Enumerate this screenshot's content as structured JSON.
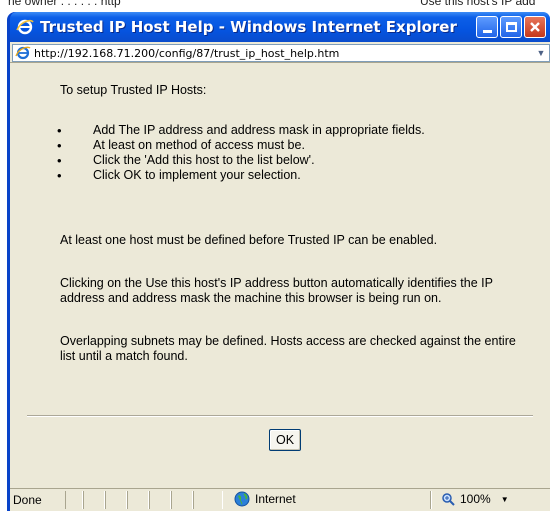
{
  "background": {
    "top_text_left": "ne owner . . . . . . http",
    "top_text_right": "Use this host's IP add"
  },
  "window": {
    "title": "Trusted IP Host Help - Windows Internet Explorer",
    "address_url": "http://192.168.71.200/config/87/trust_ip_host_help.htm"
  },
  "content": {
    "intro": "To setup Trusted IP Hosts:",
    "steps": [
      "Add The IP address and address mask in appropriate fields.",
      "At least on method of access must be.",
      "Click the 'Add this host to the list below'.",
      "Click OK to implement your selection."
    ],
    "paragraphs": [
      "At least one host must be defined before Trusted IP can be enabled.",
      "Clicking on the Use this host's IP address button automatically identifies the IP address and address mask the machine this browser is being run on.",
      "Overlapping subnets may be defined. Hosts access are checked against the entire list until a match found."
    ],
    "ok_label": "OK"
  },
  "statusbar": {
    "status": "Done",
    "zone": "Internet",
    "zoom": "100%"
  },
  "icons": {
    "title_icon": "ie-logo-icon",
    "address_icon": "ie-page-icon",
    "zone_icon": "globe-icon",
    "zoom_icon": "zoom-magnifier-icon"
  },
  "colors": {
    "titlebar": "#0554e0",
    "dialog_bg": "#ece9d8",
    "close_button": "#c4371c"
  }
}
